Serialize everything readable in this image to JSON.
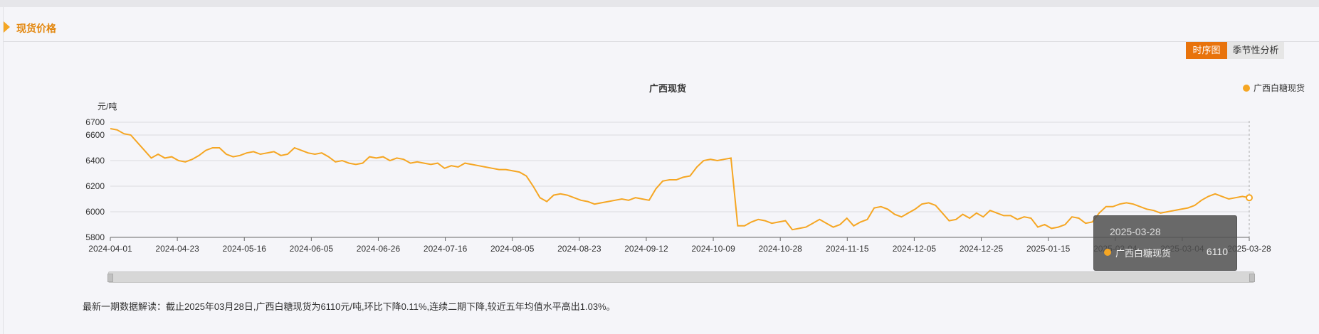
{
  "section": {
    "title": "现货价格"
  },
  "tabs": [
    {
      "label": "时序图",
      "active": true
    },
    {
      "label": "季节性分析",
      "active": false
    }
  ],
  "chart_data": {
    "type": "line",
    "title": "广西现货",
    "ylabel": "元/吨",
    "xlabel": "",
    "ylim": [
      5800,
      6700
    ],
    "yticks": [
      5800,
      6000,
      6200,
      6400,
      6600,
      6700
    ],
    "grid": true,
    "legend_position": "top-right",
    "xtick_labels": [
      "2024-04-01",
      "2024-04-23",
      "2024-05-16",
      "2024-06-05",
      "2024-06-26",
      "2024-07-16",
      "2024-08-05",
      "2024-08-23",
      "2024-09-12",
      "2024-10-09",
      "2024-10-28",
      "2024-11-15",
      "2024-12-05",
      "2024-12-25",
      "2025-01-15",
      "2025-02-04",
      "2025-03-04",
      "2025-03-28"
    ],
    "series": [
      {
        "name": "广西白糖现货",
        "color": "#f5a623",
        "values": [
          6650,
          6640,
          6610,
          6600,
          6540,
          6480,
          6420,
          6450,
          6420,
          6430,
          6400,
          6390,
          6410,
          6440,
          6480,
          6500,
          6500,
          6450,
          6430,
          6440,
          6460,
          6470,
          6450,
          6460,
          6470,
          6440,
          6450,
          6500,
          6480,
          6460,
          6450,
          6460,
          6430,
          6390,
          6400,
          6380,
          6370,
          6380,
          6430,
          6420,
          6430,
          6400,
          6420,
          6410,
          6380,
          6390,
          6380,
          6370,
          6380,
          6340,
          6360,
          6350,
          6380,
          6370,
          6360,
          6350,
          6340,
          6330,
          6330,
          6320,
          6310,
          6280,
          6200,
          6110,
          6080,
          6130,
          6140,
          6130,
          6110,
          6090,
          6080,
          6060,
          6070,
          6080,
          6090,
          6100,
          6090,
          6110,
          6100,
          6090,
          6180,
          6240,
          6250,
          6250,
          6270,
          6280,
          6350,
          6400,
          6410,
          6400,
          6410,
          6420,
          5890,
          5890,
          5920,
          5940,
          5930,
          5910,
          5920,
          5930,
          5860,
          5870,
          5880,
          5910,
          5940,
          5910,
          5880,
          5900,
          5950,
          5890,
          5920,
          5940,
          6030,
          6040,
          6020,
          5980,
          5960,
          5990,
          6020,
          6060,
          6070,
          6050,
          5990,
          5930,
          5940,
          5980,
          5950,
          5990,
          5960,
          6010,
          5990,
          5970,
          5970,
          5940,
          5960,
          5950,
          5880,
          5900,
          5870,
          5880,
          5900,
          5960,
          5950,
          5910,
          5920,
          5990,
          6040,
          6040,
          6060,
          6070,
          6060,
          6040,
          6020,
          6010,
          5990,
          6000,
          6010,
          6020,
          6030,
          6050,
          6090,
          6120,
          6140,
          6120,
          6100,
          6110,
          6120,
          6110
        ]
      }
    ]
  },
  "tooltip": {
    "date": "2025-03-28",
    "series": "广西白糖现货",
    "value": "6110"
  },
  "note": "最新一期数据解读：截止2025年03月28日,广西白糖现货为6110元/吨,环比下降0.11%,连续二期下降,较近五年均值水平高出1.03%。"
}
